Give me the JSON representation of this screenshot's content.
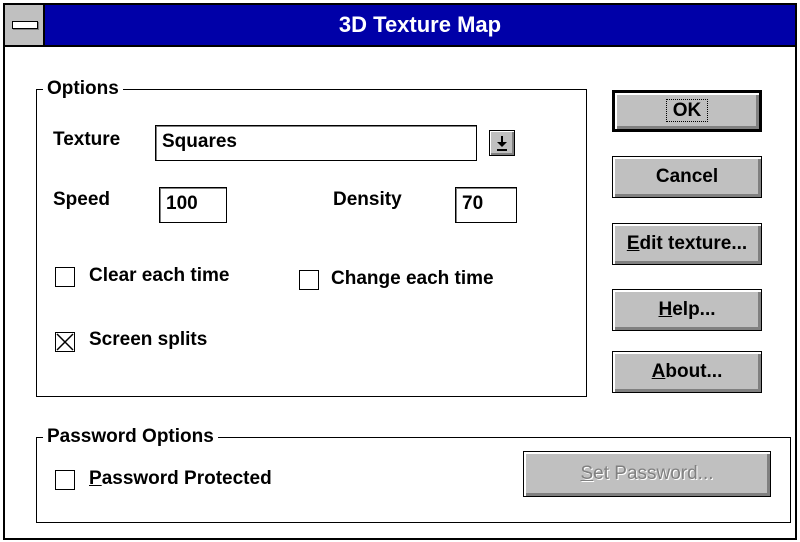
{
  "window": {
    "title": "3D Texture Map"
  },
  "options_group": {
    "label": "Options",
    "texture_label": "Texture",
    "texture_value": "Squares",
    "speed_label": "Speed",
    "speed_value": "100",
    "density_label": "Density",
    "density_value": "70",
    "clear_each_time": {
      "label": "Clear each time",
      "checked": false
    },
    "change_each_time": {
      "label": "Change each time",
      "checked": false
    },
    "screen_splits": {
      "label": "Screen splits",
      "checked": true
    }
  },
  "buttons": {
    "ok": "OK",
    "cancel": "Cancel",
    "edit_texture_mnemonic": "E",
    "edit_texture_rest": "dit texture...",
    "help_mnemonic": "H",
    "help_rest": "elp...",
    "about_mnemonic": "A",
    "about_rest": "bout..."
  },
  "password_group": {
    "label": "Password Options",
    "protected_mnemonic": "P",
    "protected_rest": "assword Protected",
    "protected_checked": false,
    "set_password_mnemonic": "S",
    "set_password_rest": "et Password...",
    "set_password_enabled": false
  },
  "icons": {
    "system_menu": "system-menu-icon",
    "dropdown": "dropdown-arrow-icon",
    "checkbox_checked": "x-mark-icon"
  },
  "colors": {
    "titlebar": "#0000a8",
    "button_face": "#c0c0c0",
    "window_bg": "#ffffff",
    "disabled_text": "#808080"
  }
}
